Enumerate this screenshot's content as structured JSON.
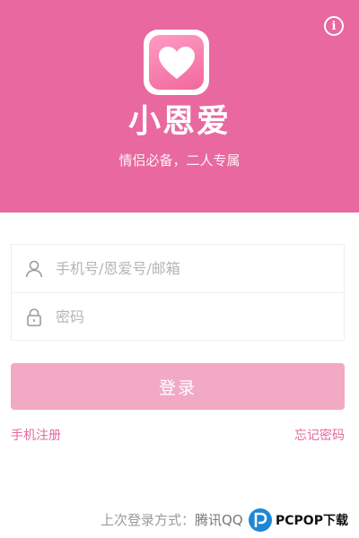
{
  "header": {
    "app_name": "小恩爱",
    "slogan": "情侣必备，二人专属",
    "info_glyph": "i",
    "brand_color": "#e8689f",
    "logo_icon": "heart-icon"
  },
  "login_form": {
    "username_placeholder": "手机号/恩爱号/邮箱",
    "password_placeholder": "密码",
    "username_icon": "user-icon",
    "password_icon": "lock-icon",
    "submit_label": "登录",
    "submit_color": "#f2a9c4"
  },
  "links": {
    "register": "手机注册",
    "forgot_password": "忘记密码"
  },
  "footer": {
    "last_login_label": "上次登录方式：",
    "last_login_method": "腾讯QQ",
    "watermark_text": "PCPOP下载"
  }
}
